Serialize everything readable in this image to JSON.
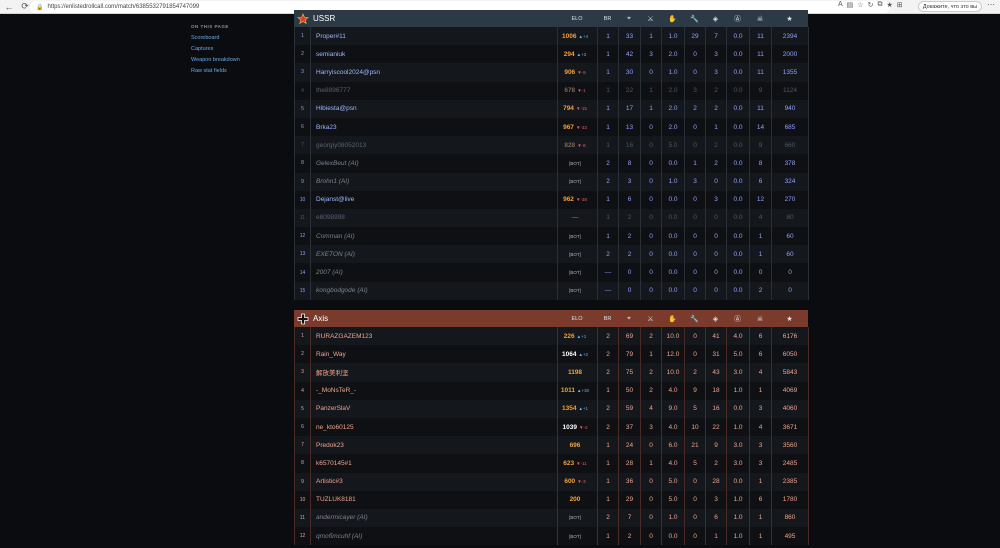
{
  "browser": {
    "url": "https://enlistedrollcall.com/match/6385532791854747099",
    "ext_label": "Докажите, что это вы"
  },
  "toc": {
    "heading": "ON THIS PAGE",
    "links": [
      "Scoreboard",
      "Captures",
      "Weapon breakdown",
      "Raw stat fields"
    ]
  },
  "columns": {
    "elo": "ELO",
    "br": "BR"
  },
  "ussr": {
    "name": "USSR",
    "rows": [
      {
        "i": "1",
        "name": "Proper#11",
        "elo": "1006",
        "d": "▲+4",
        "dir": "up",
        "br": "1",
        "c1": "33",
        "c2": "1",
        "c3": "1.0",
        "c4": "29",
        "c5": "7",
        "c6": "0.0",
        "c7": "11",
        "c8": "2394"
      },
      {
        "i": "2",
        "name": "semianiuk",
        "elo": "294",
        "d": "▲+3",
        "dir": "up",
        "br": "1",
        "c1": "42",
        "c2": "3",
        "c3": "2.0",
        "c4": "0",
        "c5": "3",
        "c6": "0.0",
        "c7": "11",
        "c8": "2000"
      },
      {
        "i": "3",
        "name": "Harryiscool2024@psn",
        "elo": "906",
        "d": "▼-9",
        "dir": "down",
        "br": "1",
        "c1": "30",
        "c2": "0",
        "c3": "1.0",
        "c4": "0",
        "c5": "3",
        "c6": "0.0",
        "c7": "11",
        "c8": "1355"
      },
      {
        "i": "4",
        "name": "the8896777",
        "elo": "678",
        "d": "▼-1",
        "dir": "down",
        "br": "1",
        "c1": "22",
        "c2": "1",
        "c3": "2.0",
        "c4": "3",
        "c5": "2",
        "c6": "0.0",
        "c7": "9",
        "c8": "1124",
        "dim": true
      },
      {
        "i": "5",
        "name": "Hibiesta@psn",
        "elo": "794",
        "d": "▼-15",
        "dir": "down",
        "br": "1",
        "c1": "17",
        "c2": "1",
        "c3": "2.0",
        "c4": "2",
        "c5": "2",
        "c6": "0.0",
        "c7": "11",
        "c8": "940"
      },
      {
        "i": "6",
        "name": "Brka23",
        "elo": "967",
        "d": "▼-33",
        "dir": "down",
        "br": "1",
        "c1": "13",
        "c2": "0",
        "c3": "2.0",
        "c4": "0",
        "c5": "1",
        "c6": "0.0",
        "c7": "14",
        "c8": "685"
      },
      {
        "i": "7",
        "name": "georgiy08052013",
        "elo": "828",
        "d": "▼-8",
        "dir": "down",
        "br": "1",
        "c1": "16",
        "c2": "0",
        "c3": "5.0",
        "c4": "0",
        "c5": "2",
        "c6": "0.0",
        "c7": "9",
        "c8": "660",
        "dim": true
      },
      {
        "i": "8",
        "name": "GelexBeut (AI)",
        "bot": true,
        "br": "2",
        "c1": "8",
        "c2": "0",
        "c3": "0.0",
        "c4": "1",
        "c5": "2",
        "c6": "0.0",
        "c7": "8",
        "c8": "378"
      },
      {
        "i": "9",
        "name": "Brohn1 (AI)",
        "bot": true,
        "br": "2",
        "c1": "3",
        "c2": "0",
        "c3": "1.0",
        "c4": "3",
        "c5": "0",
        "c6": "0.0",
        "c7": "6",
        "c8": "324"
      },
      {
        "i": "10",
        "name": "Dejanst@live",
        "elo": "962",
        "d": "▼-38",
        "dir": "down",
        "br": "1",
        "c1": "6",
        "c2": "0",
        "c3": "0.0",
        "c4": "0",
        "c5": "3",
        "c6": "0.0",
        "c7": "12",
        "c8": "270"
      },
      {
        "i": "11",
        "name": "e8098998",
        "dashelo": true,
        "br": "1",
        "c1": "2",
        "c2": "0",
        "c3": "0.0",
        "c4": "0",
        "c5": "0",
        "c6": "0.0",
        "c7": "4",
        "c8": "80",
        "dim": true
      },
      {
        "i": "12",
        "name": "Comman (AI)",
        "bot": true,
        "br": "1",
        "c1": "2",
        "c2": "0",
        "c3": "0.0",
        "c4": "0",
        "c5": "0",
        "c6": "0.0",
        "c7": "1",
        "c8": "60"
      },
      {
        "i": "13",
        "name": "EXETON (AI)",
        "bot": true,
        "br": "2",
        "c1": "2",
        "c2": "0",
        "c3": "0.0",
        "c4": "0",
        "c5": "0",
        "c6": "0.0",
        "c7": "1",
        "c8": "60"
      },
      {
        "i": "14",
        "name": "2007 (AI)",
        "bot": true,
        "br": "—",
        "c1": "0",
        "c2": "0",
        "c3": "0.0",
        "c4": "0",
        "c5": "0",
        "c6": "0.0",
        "c7": "0",
        "c8": "0"
      },
      {
        "i": "15",
        "name": "kongbodgode (AI)",
        "bot": true,
        "br": "—",
        "c1": "0",
        "c2": "0",
        "c3": "0.0",
        "c4": "0",
        "c5": "0",
        "c6": "0.0",
        "c7": "2",
        "c8": "0"
      }
    ]
  },
  "axis": {
    "name": "Axis",
    "rows": [
      {
        "i": "1",
        "name": "RURAZGAZEM123",
        "elo": "226",
        "d": "▲+1",
        "dir": "up",
        "br": "2",
        "c1": "69",
        "c2": "2",
        "c3": "10.0",
        "c4": "0",
        "c5": "41",
        "c6": "4.0",
        "c7": "6",
        "c8": "6176"
      },
      {
        "i": "2",
        "name": "Rain_Way",
        "elo": "1064",
        "d": "▲+2",
        "dir": "up",
        "white": true,
        "br": "2",
        "c1": "79",
        "c2": "1",
        "c3": "12.0",
        "c4": "0",
        "c5": "31",
        "c6": "5.0",
        "c7": "6",
        "c8": "6050"
      },
      {
        "i": "3",
        "name": "解放美利坚",
        "elo": "1198",
        "br": "2",
        "c1": "75",
        "c2": "2",
        "c3": "10.0",
        "c4": "2",
        "c5": "43",
        "c6": "3.0",
        "c7": "4",
        "c8": "5843"
      },
      {
        "i": "4",
        "name": "-_MoNsTeR_-",
        "elo": "1011",
        "d": "▲+30",
        "dir": "up",
        "br": "1",
        "c1": "50",
        "c2": "2",
        "c3": "4.0",
        "c4": "9",
        "c5": "18",
        "c6": "1.0",
        "c7": "1",
        "c8": "4069"
      },
      {
        "i": "5",
        "name": "PanzerSlaV",
        "elo": "1354",
        "d": "▲+1",
        "dir": "up",
        "br": "2",
        "c1": "59",
        "c2": "4",
        "c3": "9.0",
        "c4": "5",
        "c5": "16",
        "c6": "0.0",
        "c7": "3",
        "c8": "4060"
      },
      {
        "i": "6",
        "name": "ne_kto60125",
        "elo": "1039",
        "d": "▼-2",
        "dir": "down",
        "white": true,
        "br": "2",
        "c1": "37",
        "c2": "3",
        "c3": "4.0",
        "c4": "10",
        "c5": "22",
        "c6": "1.0",
        "c7": "4",
        "c8": "3671"
      },
      {
        "i": "7",
        "name": "Predok23",
        "elo": "696",
        "br": "1",
        "c1": "24",
        "c2": "0",
        "c3": "6.0",
        "c4": "21",
        "c5": "9",
        "c6": "3.0",
        "c7": "3",
        "c8": "3560"
      },
      {
        "i": "8",
        "name": "k6570145#1",
        "elo": "623",
        "d": "▼-11",
        "dir": "down",
        "br": "1",
        "c1": "28",
        "c2": "1",
        "c3": "4.0",
        "c4": "5",
        "c5": "2",
        "c6": "3.0",
        "c7": "3",
        "c8": "2485"
      },
      {
        "i": "9",
        "name": "Artistic#3",
        "elo": "600",
        "d": "▼-3",
        "dir": "down",
        "br": "1",
        "c1": "36",
        "c2": "0",
        "c3": "5.0",
        "c4": "0",
        "c5": "28",
        "c6": "0.0",
        "c7": "1",
        "c8": "2385"
      },
      {
        "i": "10",
        "name": "TUZLUK8181",
        "elo": "200",
        "br": "1",
        "c1": "29",
        "c2": "0",
        "c3": "5.0",
        "c4": "0",
        "c5": "3",
        "c6": "1.0",
        "c7": "6",
        "c8": "1780"
      },
      {
        "i": "11",
        "name": "andermicayer (AI)",
        "bot": true,
        "br": "2",
        "c1": "7",
        "c2": "0",
        "c3": "1.0",
        "c4": "0",
        "c5": "6",
        "c6": "1.0",
        "c7": "1",
        "c8": "860"
      },
      {
        "i": "12",
        "name": "qmoбmcuhf (AI)",
        "bot": true,
        "br": "1",
        "c1": "2",
        "c2": "0",
        "c3": "0.0",
        "c4": "0",
        "c5": "1",
        "c6": "1.0",
        "c7": "1",
        "c8": "495"
      }
    ]
  },
  "bot_label": "[BOT]",
  "dash": "—"
}
